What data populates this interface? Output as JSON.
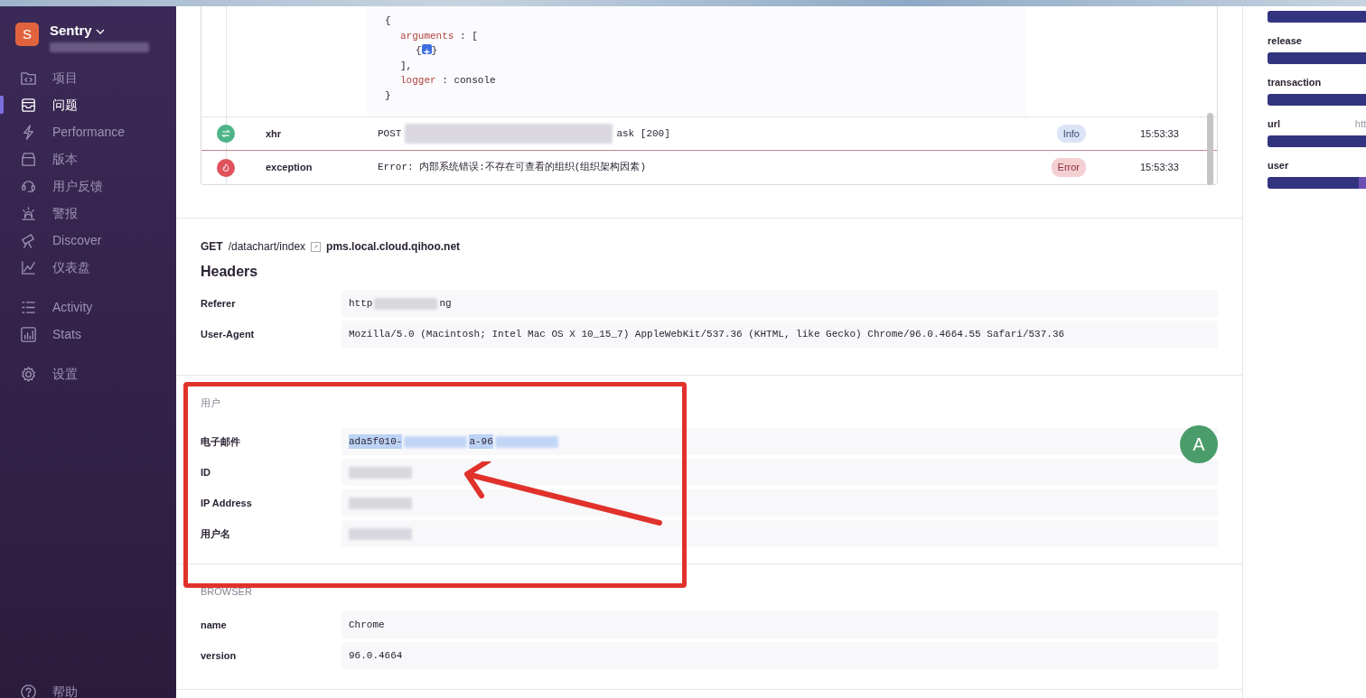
{
  "sidebar": {
    "org": {
      "initial": "S",
      "name": "Sentry",
      "subtitle": [
        {
          "kind": "redacted"
        }
      ]
    },
    "groups": [
      [
        {
          "label": "项目",
          "selected": false
        },
        {
          "label": "问题",
          "selected": true
        },
        {
          "label": "Performance",
          "selected": false
        },
        {
          "label": "版本",
          "selected": false
        },
        {
          "label": "用户反馈",
          "selected": false
        },
        {
          "label": "警报",
          "selected": false
        },
        {
          "label": "Discover",
          "selected": false
        },
        {
          "label": "仪表盘",
          "selected": false
        }
      ],
      [
        {
          "label": "Activity",
          "selected": false
        },
        {
          "label": "Stats",
          "selected": false
        }
      ],
      [
        {
          "label": "设置",
          "selected": false
        }
      ]
    ],
    "help": {
      "label": "帮助"
    }
  },
  "breadcrumbs": {
    "data": {
      "open": "{",
      "close": "}",
      "children": [
        {
          "key": "arguments",
          "sep": ":",
          "open": "[",
          "close": "],",
          "children": [
            {
              "open": "{",
              "close": "}",
              "collapsed": true
            }
          ]
        },
        {
          "key": "logger",
          "sep": ":",
          "value": "console"
        }
      ]
    },
    "rows": [
      {
        "kind": "xhr",
        "type": "xhr",
        "message": [
          {
            "text": "POST"
          },
          {
            "kind": "redacted"
          },
          {
            "text": "ask [200]"
          }
        ],
        "level": "Info",
        "time": "15:53:33"
      },
      {
        "kind": "exception",
        "type": "exception",
        "message": [
          {
            "text": "Error: 内部系统错误:不存在可查看的组织(组织架构因素)"
          }
        ],
        "level": "Error",
        "time": "15:53:33"
      }
    ]
  },
  "request": {
    "method": "GET",
    "path": "/datachart/index",
    "host": "pms.local.cloud.qihoo.net",
    "heading": "Headers",
    "rows": [
      {
        "key": "Referer",
        "value": [
          {
            "text": "http"
          },
          {
            "kind": "redacted"
          },
          {
            "text": "ng"
          }
        ]
      },
      {
        "key": "User-Agent",
        "value": [
          {
            "text": "Mozilla/5.0 (Macintosh; Intel Mac OS X 10_15_7) AppleWebKit/537.36 (KHTML, like Gecko) Chrome/96.0.4664.55 Safari/537.36"
          }
        ]
      }
    ]
  },
  "user": {
    "heading": "用户",
    "annotated": true,
    "avatar": "A",
    "rows": [
      {
        "key": "电子邮件",
        "highlighted": true,
        "value": [
          {
            "text": "ada5f010-"
          },
          {
            "kind": "redacted"
          },
          {
            "text": "a-96"
          },
          {
            "kind": "redacted"
          }
        ]
      },
      {
        "key": "ID",
        "highlighted": false,
        "value": [
          {
            "kind": "redacted"
          }
        ]
      },
      {
        "key": "IP Address",
        "highlighted": false,
        "value": [
          {
            "kind": "redacted"
          }
        ]
      },
      {
        "key": "用户名",
        "highlighted": false,
        "value": [
          {
            "kind": "redacted"
          }
        ]
      }
    ]
  },
  "browser": {
    "heading": "BROWSER",
    "rows": [
      {
        "key": "name",
        "value": [
          {
            "text": "Chrome"
          }
        ]
      },
      {
        "key": "version",
        "value": [
          {
            "text": "96.0.4664"
          }
        ]
      }
    ]
  },
  "tags": [
    {
      "kind": "bar"
    },
    {
      "kind": "labeled",
      "label": "release"
    },
    {
      "kind": "labeled",
      "label": "transaction"
    },
    {
      "kind": "labeled",
      "label": "url",
      "value": "htt"
    },
    {
      "kind": "labeled",
      "label": "user",
      "split": true
    }
  ]
}
